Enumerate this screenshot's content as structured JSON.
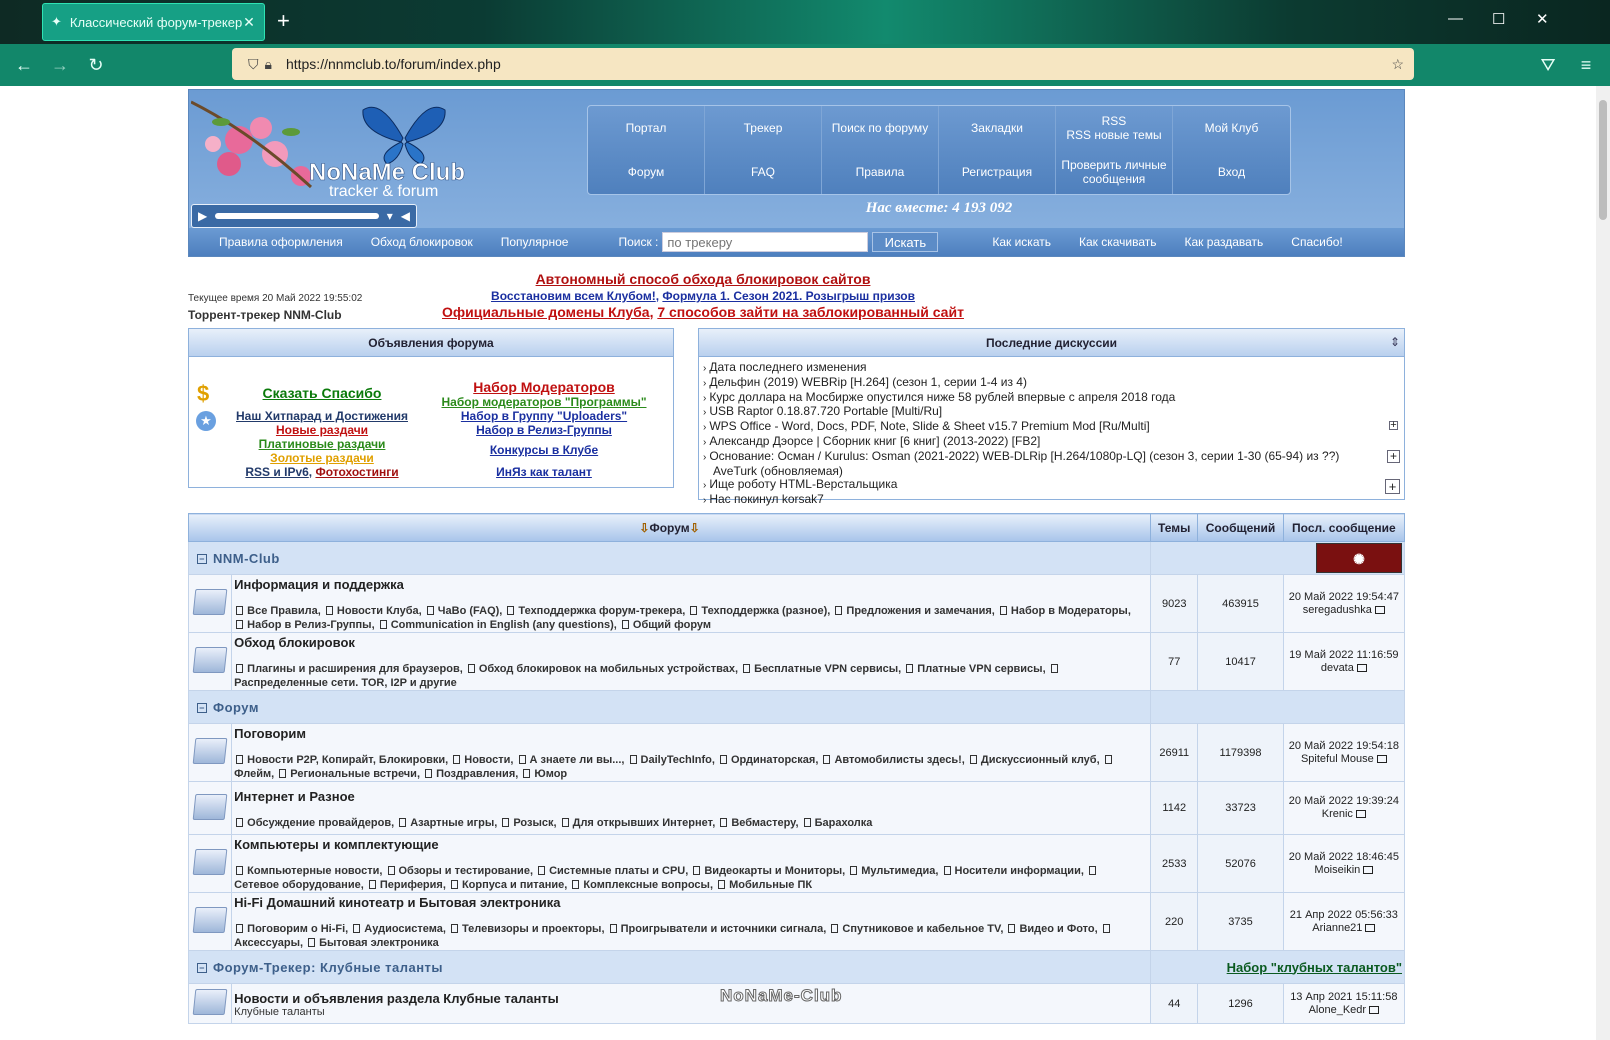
{
  "browser": {
    "tab_title": "Классический форум-трекер",
    "url": "https://nnmclub.to/forum/index.php"
  },
  "header": {
    "logo_title": "NoNaMe Club",
    "logo_sub": "tracker & forum",
    "menu": [
      "Портал",
      "Трекер",
      "Поиск по форуму",
      "Закладки",
      "RSS\nRSS новые темы",
      "Мой Клуб",
      "Форум",
      "FAQ",
      "Правила",
      "Регистрация",
      "Проверить личные сообщения",
      "Вход"
    ],
    "together": "Нас вместе: 4 193 092",
    "subnav_left": [
      "Правила оформления",
      "Обход блокировок",
      "Популярное"
    ],
    "search_label": "Поиск :",
    "search_placeholder": "по трекеру",
    "search_button": "Искать",
    "subnav_right": [
      "Как искать",
      "Как скачивать",
      "Как раздавать",
      "Спасибо!"
    ]
  },
  "announce": {
    "line1": "Автономный способ обхода блокировок сайтов",
    "line2a": "Восстановим всем Клубом!",
    "line2b": "Формула 1. Сезон 2021. Розыгрыш призов",
    "line3a": "Официальные домены Клуба",
    "line3b": "7 способов зайти на заблокированный сайт",
    "time": "Текущее время 20 Май 2022 19:55:02",
    "site": "Торрент-трекер NNM-Club"
  },
  "ann_panel": {
    "title": "Объявления форума",
    "left": [
      {
        "t": "Сказать Спасибо",
        "c": "#0a7a0a"
      },
      {
        "t": "Наш Хитпарад и Достижения",
        "c": "#223a6a"
      },
      {
        "t": "Новые раздачи",
        "c": "#c01010"
      },
      {
        "t": "Платиновые раздачи",
        "c": "#2a8a1a"
      },
      {
        "t": "Золотые раздачи",
        "c": "#e0a000"
      }
    ],
    "rss": "RSS и IPv6",
    "photo": "Фотохостинги",
    "right": [
      {
        "t": "Набор Модераторов",
        "c": "#c01010"
      },
      {
        "t": "Набор модераторов \"Программы\"",
        "c": "#2a8a1a"
      },
      {
        "t": "Набор в Группу \"Uploaders\"",
        "c": "#1a2fa0"
      },
      {
        "t": "Набор в Релиз-Группы",
        "c": "#1a2fa0"
      },
      {
        "t": "Конкурсы в Клубе",
        "c": "#1a2fa0"
      },
      {
        "t": "ИнЯз как талант",
        "c": "#1a2fa0"
      }
    ]
  },
  "disc_panel": {
    "title": "Последние дискуссии",
    "items": [
      "Дата последнего изменения",
      "Дельфин (2019) WEBRip [H.264] (сезон 1, серии 1-4 из 4)",
      "Курс доллара на Мосбирже опустился ниже 58 рублей впервые с апреля 2018 года",
      "USB Raptor 0.18.87.720 Portable [Multi/Ru]",
      "WPS Office - Word, Docs, PDF, Note, Slide & Sheet v15.7 Premium Mod [Ru/Multi]",
      "Александр Дэорсе | Сборник книг [6 книг] (2013-2022) [FB2]",
      "Основание: Осман / Kurulus: Osman (2021-2022) WEB-DLRip [H.264/1080p-LQ] (сезон 3, серии 1-30 (65-94) из ??)",
      "AveTurk (обновляемая)",
      "Ище роботу HTML-Верстальщика",
      "Нас покинул korsak7"
    ]
  },
  "forum_table": {
    "col_forum": "Форум",
    "col_topics": "Темы",
    "col_posts": "Сообщений",
    "col_last": "Посл. сообщение",
    "categories": [
      {
        "name": "NNM-Club",
        "right": "",
        "forums": [
          {
            "name": "Информация и поддержка",
            "desc": "",
            "subs": [
              "Все Правила",
              "Новости Клуба",
              "ЧаВо (FAQ)",
              "Техподдержка форум-трекера",
              "Техподдержка (разное)",
              "Предложения и замечания",
              "Набор в Модераторы",
              "Набор в Релиз-Группы",
              "Communication in English (any questions)",
              "Общий форум"
            ],
            "topics": "9023",
            "posts": "463915",
            "last_date": "20 Май 2022 19:54:47",
            "last_user": "seregadushka"
          },
          {
            "name": "Обход блокировок",
            "desc": "",
            "subs": [
              "Плагины и расширения для браузеров",
              "Обход блокировок на мобильных устройствах",
              "Бесплатные VPN сервисы",
              "Платные VPN сервисы",
              "Распределенные сети. TOR, I2P и другие"
            ],
            "topics": "77",
            "posts": "10417",
            "last_date": "19 Май 2022 11:16:59",
            "last_user": "devata"
          }
        ]
      },
      {
        "name": "Форум",
        "right": "",
        "forums": [
          {
            "name": "Поговорим",
            "desc": "",
            "subs": [
              "Новости P2P, Копирайт, Блокировки",
              "Новости",
              "А знаете ли вы...",
              "DailyTechInfo",
              "Ординаторская",
              "Автомобилисты здесь!",
              "Дискуссионный клуб",
              "Флейм",
              "Региональные встречи",
              "Поздравления",
              "Юмор"
            ],
            "topics": "26911",
            "posts": "1179398",
            "last_date": "20 Май 2022 19:54:18",
            "last_user": "Spiteful Mouse"
          },
          {
            "name": "Интернет и Разное",
            "desc": "",
            "subs": [
              "Обсуждение провайдеров",
              "Азартные игры",
              "Розыск",
              "Для открывших Интернет",
              "Вебмастеру",
              "Барахолка"
            ],
            "topics": "1142",
            "posts": "33723",
            "last_date": "20 Май 2022 19:39:24",
            "last_user": "Krenic"
          },
          {
            "name": "Компьютеры и комплектующие",
            "desc": "",
            "subs": [
              "Компьютерные новости",
              "Обзоры и тестирование",
              "Системные платы и CPU",
              "Видеокарты и Мониторы",
              "Мультимедиа",
              "Носители информации",
              "Сетевое оборудование",
              "Периферия",
              "Корпуса и питание",
              "Комплексные вопросы",
              "Мобильные ПК"
            ],
            "topics": "2533",
            "posts": "52076",
            "last_date": "20 Май 2022 18:46:45",
            "last_user": "Moiseikin"
          },
          {
            "name": "Hi-Fi Домашний кинотеатр и Бытовая электроника",
            "desc": "",
            "subs": [
              "Поговорим о Hi-Fi",
              "Аудиосистема",
              "Телевизоры и проекторы",
              "Проигрыватели и источники сигнала",
              "Спутниковое и кабельное TV",
              "Видео и Фото",
              "Аксессуары",
              "Бытовая электроника"
            ],
            "topics": "220",
            "posts": "3735",
            "last_date": "21 Апр 2022 05:56:33",
            "last_user": "Arianne21"
          }
        ]
      },
      {
        "name": "Форум-Трекер: Клубные таланты",
        "right": "Набор \"клубных талантов\"",
        "forums": [
          {
            "name": "Новости и объявления раздела Клубные таланты",
            "desc": "Клубные таланты",
            "subs": [],
            "topics": "44",
            "posts": "1296",
            "last_date": "13 Апр 2021 15:11:58",
            "last_user": "Alone_Kedr"
          }
        ]
      }
    ]
  },
  "watermark": "NoNaMe-Club",
  "colors": {
    "accent": "#16a085",
    "header_blue": "#6b9bd3",
    "link_red": "#c01010",
    "link_blue": "#1a2fa0"
  }
}
